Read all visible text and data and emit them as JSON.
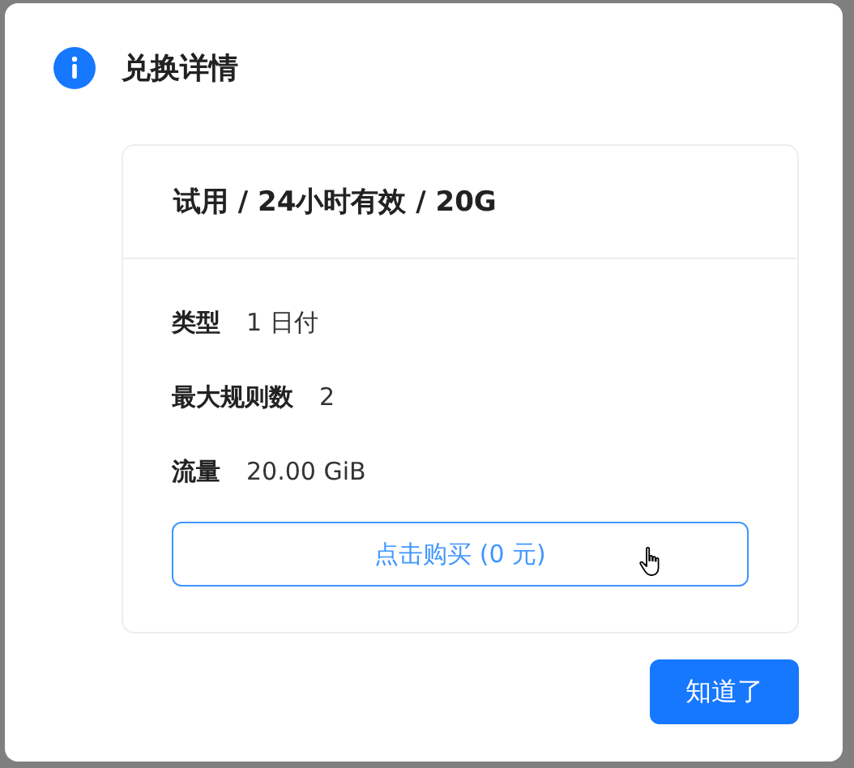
{
  "dialog": {
    "title": "兑换详情"
  },
  "card": {
    "title": "试用 / 24小时有效 / 20G",
    "fields": [
      {
        "label": "类型",
        "value": "1 日付"
      },
      {
        "label": "最大规则数",
        "value": "2"
      },
      {
        "label": "流量",
        "value": "20.00 GiB"
      }
    ],
    "buy_button": "点击购买 (0 元)"
  },
  "ok_button": "知道了"
}
